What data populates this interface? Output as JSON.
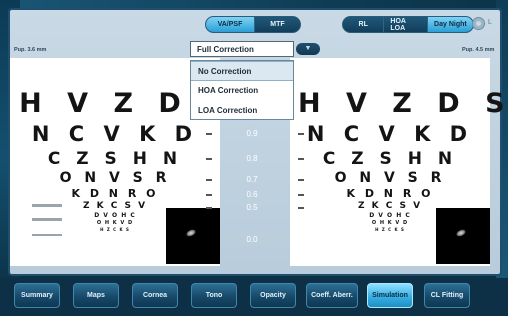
{
  "top_toggles": {
    "left_group": [
      {
        "label": "VA/PSF",
        "active": true
      },
      {
        "label": "MTF",
        "active": false
      }
    ],
    "right_group": [
      {
        "label": "RL",
        "active": false
      },
      {
        "label": "HOA LOA",
        "active": false
      },
      {
        "label": "Day Night",
        "active": true
      }
    ],
    "side_label": "L"
  },
  "pupil": {
    "left": "Pup. 3.6 mm",
    "right": "Pup. 4.5 mm"
  },
  "correction_dropdown": {
    "selected": "Full Correction",
    "options": [
      "No Correction",
      "HOA Correction",
      "LOA Correction"
    ],
    "highlighted": "No Correction"
  },
  "chart_rows": {
    "left": [
      "H V Z D",
      "N C V K D",
      "C Z S H N",
      "O N V S R",
      "K D N R O",
      "Z K C S V",
      "D V O H C",
      "O H K V D",
      "H Z C K S"
    ],
    "right": [
      "H V Z D S",
      "N C V K D",
      "C Z S H N",
      "O N V S R",
      "K D N R O",
      "Z K C S V",
      "D V O H C",
      "O H K V D",
      "H Z C K S"
    ]
  },
  "acuity_values": [
    "0.9",
    "0.8",
    "0.7",
    "0.6",
    "0.5",
    "0.0"
  ],
  "nav_tabs": [
    {
      "label": "Summary",
      "active": false
    },
    {
      "label": "Maps",
      "active": false
    },
    {
      "label": "Cornea",
      "active": false
    },
    {
      "label": "Tono",
      "active": false
    },
    {
      "label": "Opacity",
      "active": false
    },
    {
      "label": "Coeff. Aberr.",
      "active": false
    },
    {
      "label": "Simulation",
      "active": true
    },
    {
      "label": "CL Fitting",
      "active": false
    }
  ],
  "colors": {
    "active_accent": "#39b0e4",
    "frame_bg": "#c9d9e5",
    "nav_bg": "#0e3046"
  }
}
